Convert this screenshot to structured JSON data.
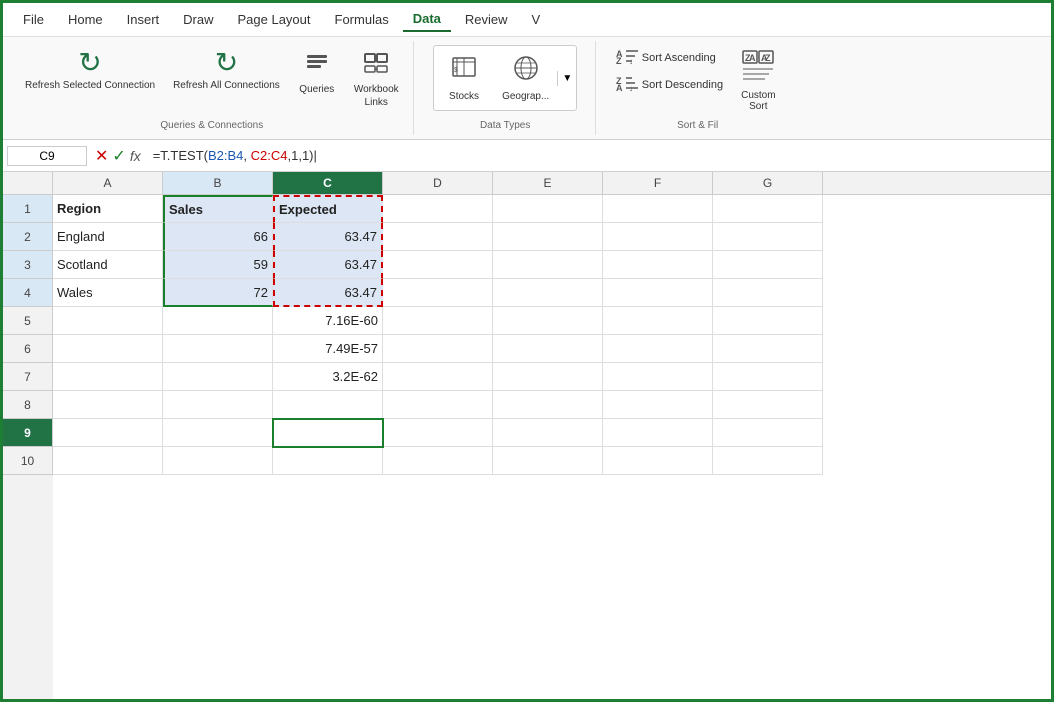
{
  "menu": {
    "items": [
      "File",
      "Home",
      "Insert",
      "Draw",
      "Page Layout",
      "Formulas",
      "Data",
      "Review",
      "V"
    ],
    "active": "Data"
  },
  "ribbon": {
    "groups": [
      {
        "name": "queries-connections",
        "label": "Queries & Connections",
        "buttons": [
          {
            "id": "refresh-selected",
            "label": "Refresh Selected\nConnection",
            "icon": "↻"
          },
          {
            "id": "refresh-all",
            "label": "Refresh All\nConnections",
            "icon": "↻"
          },
          {
            "id": "queries",
            "label": "Queries",
            "icon": "≡"
          },
          {
            "id": "workbook-links",
            "label": "Workbook\nLinks",
            "icon": "🔗"
          }
        ]
      },
      {
        "name": "data-types",
        "label": "Data Types",
        "buttons": [
          {
            "id": "stocks",
            "label": "Stocks",
            "icon": "🏛"
          },
          {
            "id": "geography",
            "label": "Geograp...",
            "icon": "🗺"
          }
        ]
      },
      {
        "name": "sort-filter",
        "label": "Sort & Fil",
        "items": [
          {
            "id": "sort-ascending",
            "label": "Sort Ascending",
            "icon": "A↑Z"
          },
          {
            "id": "sort-descending",
            "label": "Sort Descending",
            "icon": "Z↑A"
          }
        ],
        "custom": {
          "label": "Custom\nSort",
          "icon": "ZA"
        }
      }
    ]
  },
  "formula_bar": {
    "cell_ref": "C9",
    "formula": "=T.TEST(B2:B4, C2:C4,1,1)"
  },
  "spreadsheet": {
    "col_headers": [
      "A",
      "B",
      "C",
      "D",
      "E",
      "F",
      "G"
    ],
    "rows": [
      {
        "row": 1,
        "cells": [
          "Region",
          "Sales",
          "Expected",
          "",
          "",
          "",
          ""
        ]
      },
      {
        "row": 2,
        "cells": [
          "England",
          "66",
          "63.47",
          "",
          "",
          "",
          ""
        ]
      },
      {
        "row": 3,
        "cells": [
          "Scotland",
          "59",
          "63.47",
          "",
          "",
          "",
          ""
        ]
      },
      {
        "row": 4,
        "cells": [
          "Wales",
          "72",
          "63.47",
          "",
          "",
          "",
          ""
        ]
      },
      {
        "row": 5,
        "cells": [
          "",
          "",
          "7.16E-60",
          "",
          "",
          "",
          ""
        ]
      },
      {
        "row": 6,
        "cells": [
          "",
          "",
          "7.49E-57",
          "",
          "",
          "",
          ""
        ]
      },
      {
        "row": 7,
        "cells": [
          "",
          "",
          "3.2E-62",
          "",
          "",
          "",
          ""
        ]
      },
      {
        "row": 8,
        "cells": [
          "",
          "",
          "",
          "",
          "",
          "",
          ""
        ]
      },
      {
        "row": 9,
        "cells": [
          "",
          "",
          "=T.TEST(B2:B4, C2:C4,1,1)",
          "",
          "",
          "",
          ""
        ]
      },
      {
        "row": 10,
        "cells": [
          "",
          "",
          "",
          "",
          "",
          "",
          ""
        ]
      }
    ],
    "active_cell": "C9",
    "formula_popup": "=T.TEST(B2:B4, C2:C4,1,1)"
  }
}
